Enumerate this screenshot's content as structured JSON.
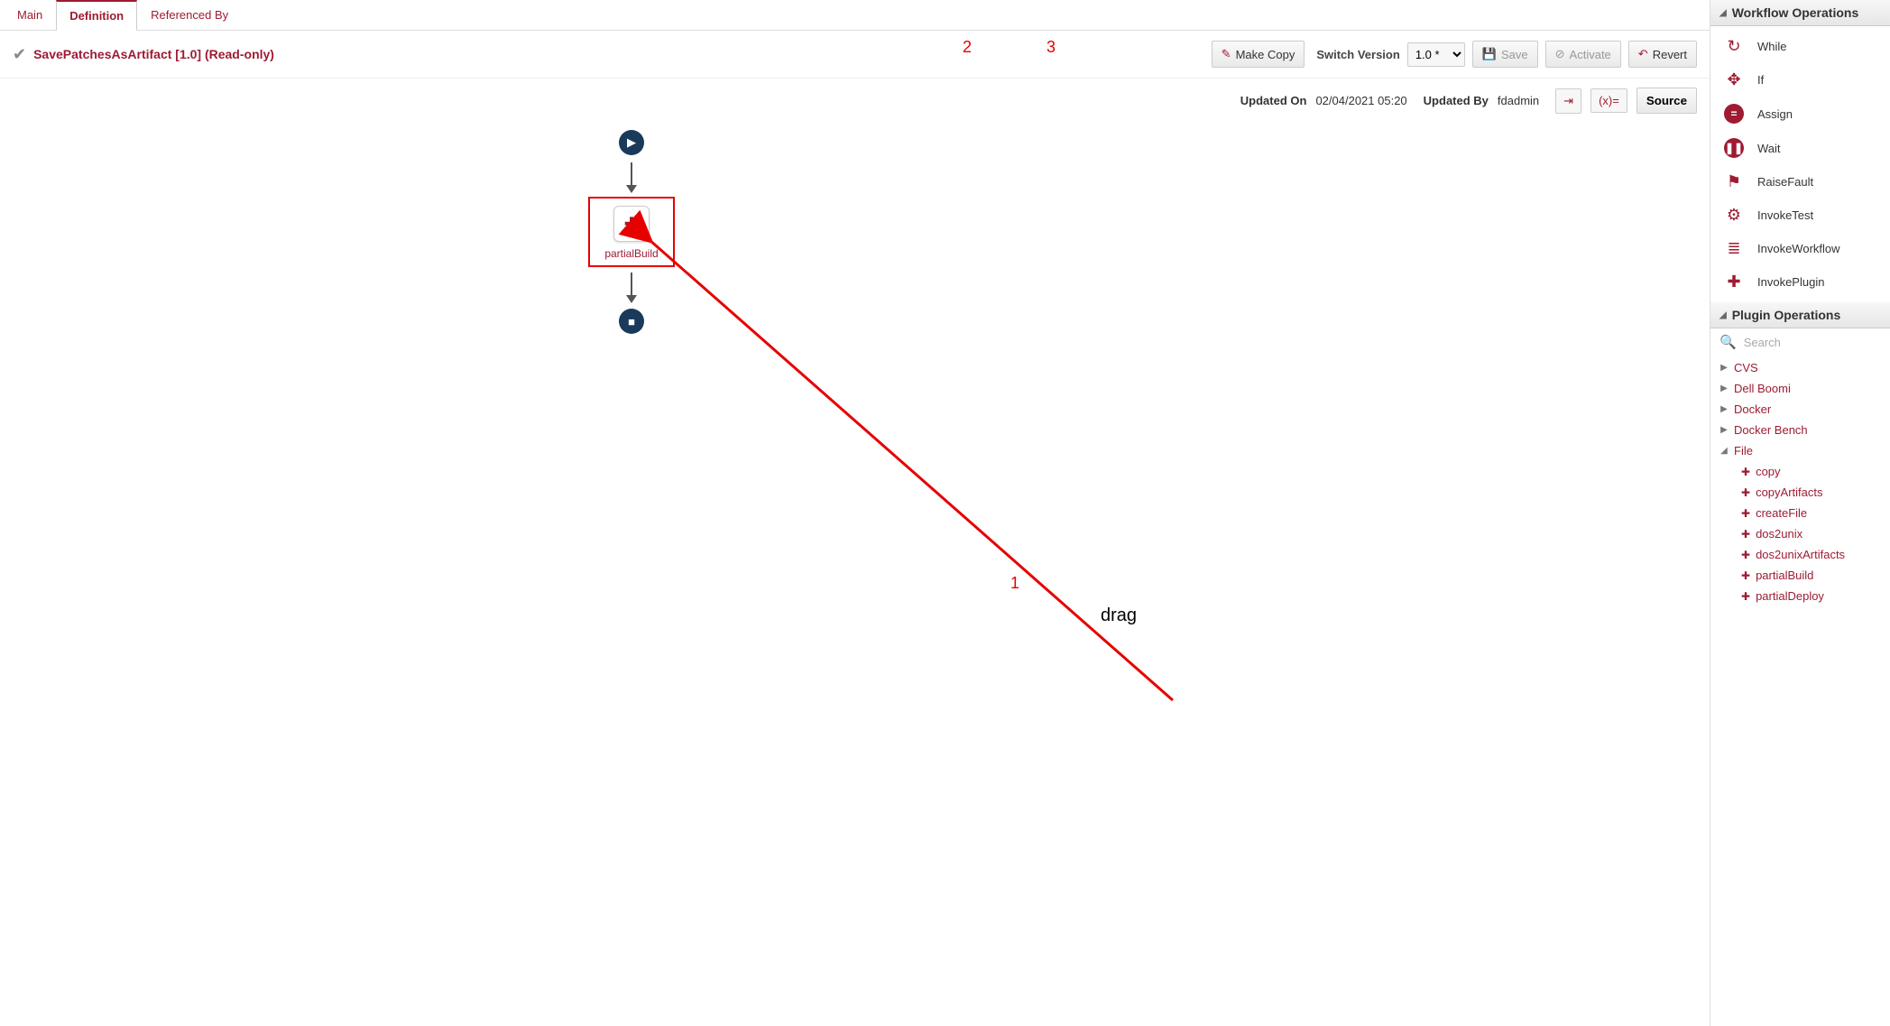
{
  "tabs": {
    "main": "Main",
    "definition": "Definition",
    "referenced": "Referenced By"
  },
  "header": {
    "title": "SavePatchesAsArtifact [1.0] (Read-only)",
    "make_copy": "Make Copy",
    "switch_version": "Switch Version",
    "version_selected": "1.0 *",
    "save": "Save",
    "activate": "Activate",
    "revert": "Revert"
  },
  "info": {
    "updated_on_label": "Updated On",
    "updated_on_value": "02/04/2021 05:20",
    "updated_by_label": "Updated By",
    "updated_by_value": "fdadmin",
    "source_label": "Source"
  },
  "flow": {
    "plugin_name": "partialBuild"
  },
  "annotations": {
    "one": "1",
    "two": "2",
    "three": "3",
    "drag": "drag"
  },
  "workflow_ops": {
    "title": "Workflow Operations",
    "items": [
      {
        "id": "while",
        "icon": "↻",
        "label": "While"
      },
      {
        "id": "if",
        "icon": "✥",
        "label": "If"
      },
      {
        "id": "assign",
        "icon": "=",
        "label": "Assign",
        "circ": true
      },
      {
        "id": "wait",
        "icon": "❚❚",
        "label": "Wait",
        "circ": true
      },
      {
        "id": "raise",
        "icon": "⚑",
        "label": "RaiseFault"
      },
      {
        "id": "invoketest",
        "icon": "⚙",
        "label": "InvokeTest"
      },
      {
        "id": "invokewf",
        "icon": "≣",
        "label": "InvokeWorkflow"
      },
      {
        "id": "invokeplugin",
        "icon": "✚",
        "label": "InvokePlugin"
      }
    ]
  },
  "plugin_ops": {
    "title": "Plugin Operations",
    "search_placeholder": "Search",
    "categories": [
      {
        "label": "CVS",
        "open": false
      },
      {
        "label": "Dell Boomi",
        "open": false
      },
      {
        "label": "Docker",
        "open": false
      },
      {
        "label": "Docker Bench",
        "open": false
      },
      {
        "label": "File",
        "open": true,
        "children": [
          "copy",
          "copyArtifacts",
          "createFile",
          "dos2unix",
          "dos2unixArtifacts",
          "partialBuild",
          "partialDeploy"
        ]
      }
    ]
  }
}
